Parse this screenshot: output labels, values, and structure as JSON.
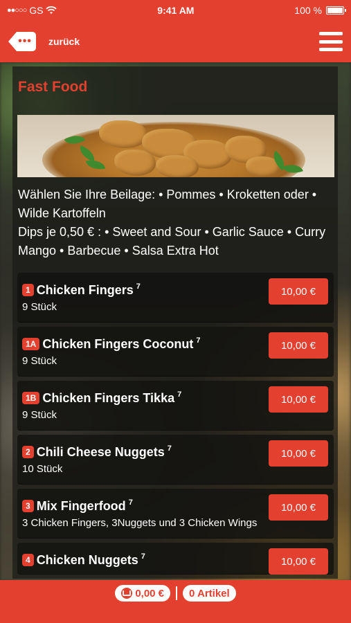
{
  "status_bar": {
    "carrier": "GS",
    "signal_dots": "●●○○○",
    "time": "9:41 AM",
    "battery_text": "100 %"
  },
  "header": {
    "back_label": "zurück",
    "back_icon_text": "•••"
  },
  "section": {
    "title": "Fast Food",
    "description_line1": "Wählen Sie Ihre Beilage: • Pommes • Kroketten oder • Wilde Kartoffeln",
    "description_line2": "Dips je 0,50 € : • Sweet and Sour • Garlic Sauce • Curry Mango • Barbecue • Salsa Extra Hot"
  },
  "items": [
    {
      "number": "1",
      "name": "Chicken Fingers",
      "sup": "7",
      "desc": "9 Stück",
      "price": "10,00 €"
    },
    {
      "number": "1A",
      "name": "Chicken Fingers Coconut",
      "sup": "7",
      "desc": "9 Stück",
      "price": "10,00 €"
    },
    {
      "number": "1B",
      "name": "Chicken Fingers Tikka",
      "sup": "7",
      "desc": "9 Stück",
      "price": "10,00 €"
    },
    {
      "number": "2",
      "name": "Chili Cheese Nuggets",
      "sup": "7",
      "desc": "10 Stück",
      "price": "10,00 €"
    },
    {
      "number": "3",
      "name": "Mix Fingerfood",
      "sup": "7",
      "desc": "3 Chicken Fingers, 3Nuggets und 3 Chicken Wings",
      "price": "10,00 €"
    },
    {
      "number": "4",
      "name": "Chicken Nuggets",
      "sup": "7",
      "desc": "",
      "price": "10,00 €"
    }
  ],
  "footer": {
    "cart_total": "0,00 €",
    "article_count": "0 Artikel"
  },
  "colors": {
    "accent": "#e3402f"
  }
}
